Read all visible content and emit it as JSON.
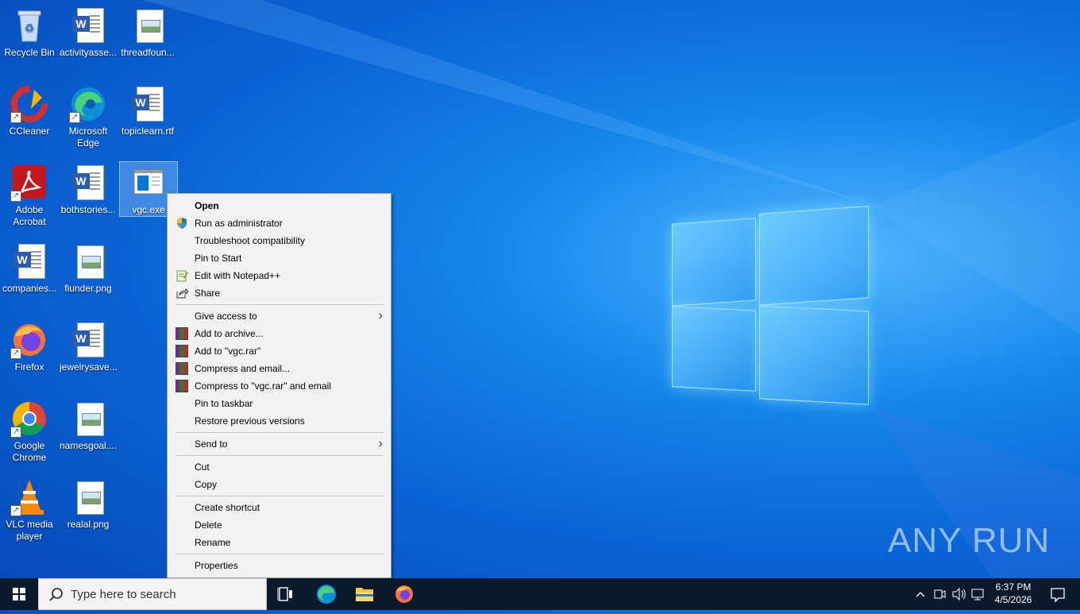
{
  "desktop": {
    "icons": [
      {
        "label": "Recycle Bin"
      },
      {
        "label": "activityasse..."
      },
      {
        "label": "threadfoun..."
      },
      {
        "label": "CCleaner"
      },
      {
        "label": "Microsoft Edge"
      },
      {
        "label": "topiclearn.rtf"
      },
      {
        "label": "Adobe Acrobat"
      },
      {
        "label": "bothstories..."
      },
      {
        "label": "vgc.exe"
      },
      {
        "label": "companies..."
      },
      {
        "label": "fiunder.png"
      },
      {
        "label": "Firefox"
      },
      {
        "label": "jewelrysave..."
      },
      {
        "label": "Google Chrome"
      },
      {
        "label": "namesgoal...."
      },
      {
        "label": "VLC media player"
      },
      {
        "label": "realal.png"
      }
    ]
  },
  "context_menu": {
    "items": [
      {
        "label": "Open"
      },
      {
        "label": "Run as administrator"
      },
      {
        "label": "Troubleshoot compatibility"
      },
      {
        "label": "Pin to Start"
      },
      {
        "label": "Edit with Notepad++"
      },
      {
        "label": "Share"
      },
      {
        "label": "Give access to"
      },
      {
        "label": "Add to archive..."
      },
      {
        "label": "Add to \"vgc.rar\""
      },
      {
        "label": "Compress and email..."
      },
      {
        "label": "Compress to \"vgc.rar\" and email"
      },
      {
        "label": "Pin to taskbar"
      },
      {
        "label": "Restore previous versions"
      },
      {
        "label": "Send to"
      },
      {
        "label": "Cut"
      },
      {
        "label": "Copy"
      },
      {
        "label": "Create shortcut"
      },
      {
        "label": "Delete"
      },
      {
        "label": "Rename"
      },
      {
        "label": "Properties"
      }
    ]
  },
  "taskbar": {
    "search_placeholder": "Type here to search",
    "time": "6:37 PM",
    "date": "4/5/2026"
  },
  "watermark": "ANY RUN",
  "colors": {
    "desktop_accent": "#0a63d6",
    "taskbar": "#0b1a2c",
    "menu_bg": "#f2f2f2"
  }
}
